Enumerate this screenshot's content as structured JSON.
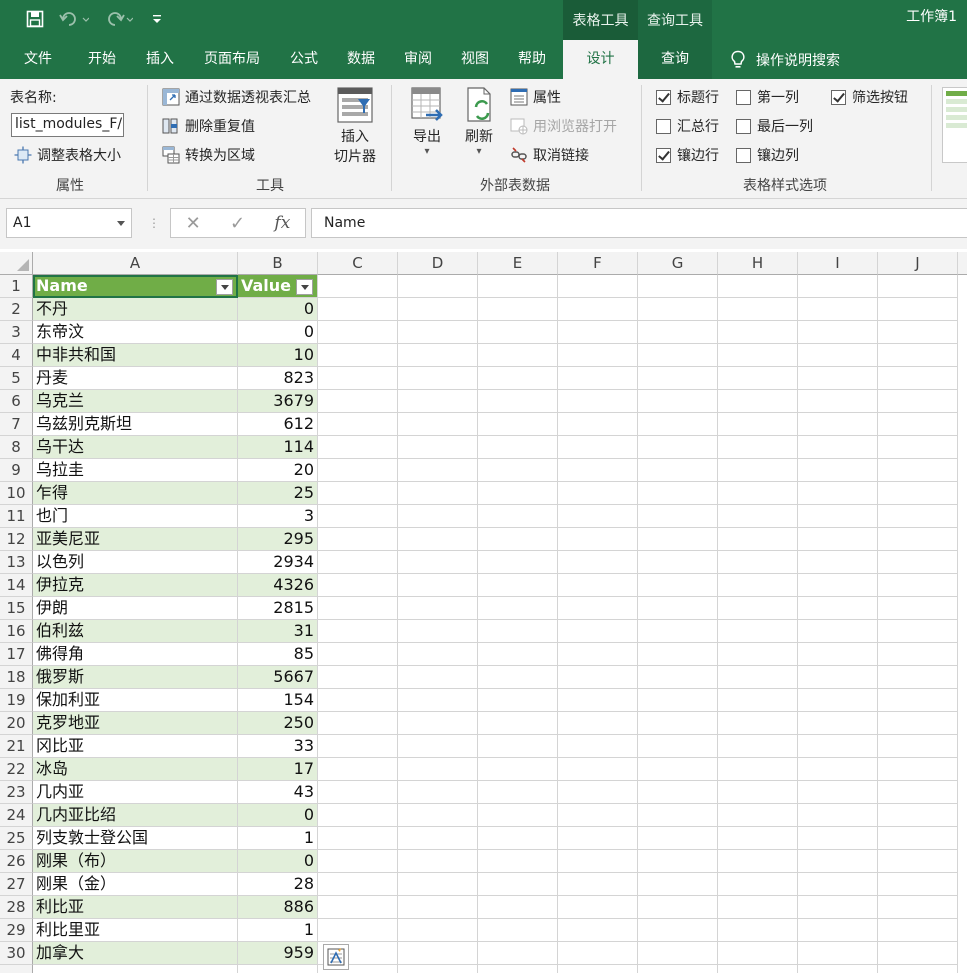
{
  "window": {
    "title": "工作簿1",
    "context_tabs": [
      "表格工具",
      "查询工具"
    ]
  },
  "ribbon_tabs": [
    {
      "label": "文件"
    },
    {
      "label": "开始"
    },
    {
      "label": "插入"
    },
    {
      "label": "页面布局"
    },
    {
      "label": "公式"
    },
    {
      "label": "数据"
    },
    {
      "label": "审阅"
    },
    {
      "label": "视图"
    },
    {
      "label": "帮助"
    },
    {
      "label": "设计"
    },
    {
      "label": "查询"
    }
  ],
  "tell_me": "操作说明搜索",
  "ribbon": {
    "properties": {
      "table_name_label": "表名称:",
      "table_name_value": "list_modules_F/",
      "resize_label": "调整表格大小",
      "group_label": "属性"
    },
    "tools": {
      "pivot_label": "通过数据透视表汇总",
      "dedupe_label": "删除重复值",
      "convert_label": "转换为区域",
      "slicer_label_1": "插入",
      "slicer_label_2": "切片器",
      "group_label": "工具"
    },
    "external": {
      "export_label": "导出",
      "refresh_label": "刷新",
      "properties_label": "属性",
      "browser_label": "用浏览器打开",
      "unlink_label": "取消链接",
      "group_label": "外部表数据"
    },
    "style_options": {
      "header_row": {
        "label": "标题行",
        "checked": true
      },
      "total_row": {
        "label": "汇总行",
        "checked": false
      },
      "banded_rows": {
        "label": "镶边行",
        "checked": true
      },
      "first_column": {
        "label": "第一列",
        "checked": false
      },
      "last_column": {
        "label": "最后一列",
        "checked": false
      },
      "banded_columns": {
        "label": "镶边列",
        "checked": false
      },
      "filter_button": {
        "label": "筛选按钮",
        "checked": true
      },
      "group_label": "表格样式选项"
    }
  },
  "formula_bar": {
    "name_box": "A1",
    "formula": "Name"
  },
  "columns": [
    "A",
    "B",
    "C",
    "D",
    "E",
    "F",
    "G",
    "H",
    "I",
    "J"
  ],
  "table": {
    "header": {
      "name": "Name",
      "value": "Value"
    },
    "rows": [
      {
        "row": "2",
        "name": "不丹",
        "value": "0"
      },
      {
        "row": "3",
        "name": "东帝汶",
        "value": "0"
      },
      {
        "row": "4",
        "name": "中非共和国",
        "value": "10"
      },
      {
        "row": "5",
        "name": "丹麦",
        "value": "823"
      },
      {
        "row": "6",
        "name": "乌克兰",
        "value": "3679"
      },
      {
        "row": "7",
        "name": "乌兹别克斯坦",
        "value": "612"
      },
      {
        "row": "8",
        "name": "乌干达",
        "value": "114"
      },
      {
        "row": "9",
        "name": "乌拉圭",
        "value": "20"
      },
      {
        "row": "10",
        "name": "乍得",
        "value": "25"
      },
      {
        "row": "11",
        "name": "也门",
        "value": "3"
      },
      {
        "row": "12",
        "name": "亚美尼亚",
        "value": "295"
      },
      {
        "row": "13",
        "name": "以色列",
        "value": "2934"
      },
      {
        "row": "14",
        "name": "伊拉克",
        "value": "4326"
      },
      {
        "row": "15",
        "name": "伊朗",
        "value": "2815"
      },
      {
        "row": "16",
        "name": "伯利兹",
        "value": "31"
      },
      {
        "row": "17",
        "name": "佛得角",
        "value": "85"
      },
      {
        "row": "18",
        "name": "俄罗斯",
        "value": "5667"
      },
      {
        "row": "19",
        "name": "保加利亚",
        "value": "154"
      },
      {
        "row": "20",
        "name": "克罗地亚",
        "value": "250"
      },
      {
        "row": "21",
        "name": "冈比亚",
        "value": "33"
      },
      {
        "row": "22",
        "name": "冰岛",
        "value": "17"
      },
      {
        "row": "23",
        "name": "几内亚",
        "value": "43"
      },
      {
        "row": "24",
        "name": "几内亚比绍",
        "value": "0"
      },
      {
        "row": "25",
        "name": "列支敦士登公国",
        "value": "1"
      },
      {
        "row": "26",
        "name": "刚果（布）",
        "value": "0"
      },
      {
        "row": "27",
        "name": "刚果（金）",
        "value": "28"
      },
      {
        "row": "28",
        "name": "利比亚",
        "value": "886"
      },
      {
        "row": "29",
        "name": "利比里亚",
        "value": "1"
      },
      {
        "row": "30",
        "name": "加拿大",
        "value": "959"
      }
    ]
  }
}
